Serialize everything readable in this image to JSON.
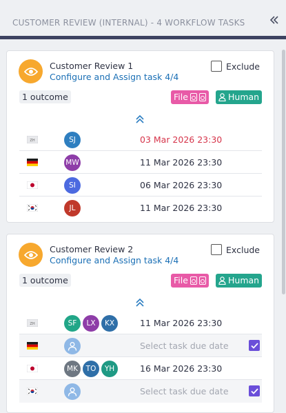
{
  "header": {
    "title": "CUSTOMER REVIEW (INTERNAL) - 4 WORKFLOW TASKS",
    "collapse_icon": "double-chevron-left-icon"
  },
  "cards": [
    {
      "name": "Customer Review 1",
      "subtitle": "Configure and Assign task 4/4",
      "exclude_label": "Exclude",
      "outcome": "1 outcome",
      "tag_file": "File",
      "tag_human": "Human",
      "rows": [
        {
          "flag": "zh",
          "avatars": [
            {
              "initials": "SJ",
              "color": "#2f7fc0"
            }
          ],
          "date": "03 Mar 2026 23:30",
          "overdue": true
        },
        {
          "flag": "de",
          "avatars": [
            {
              "initials": "MW",
              "color": "#8e3da8"
            }
          ],
          "date": "11 Mar 2026 23:30"
        },
        {
          "flag": "jp",
          "avatars": [
            {
              "initials": "SI",
              "color": "#4c6ae0"
            }
          ],
          "date": "06 Mar 2026 23:30"
        },
        {
          "flag": "kr",
          "avatars": [
            {
              "initials": "JL",
              "color": "#c0392b"
            }
          ],
          "date": "11 Mar 2026 23:30"
        }
      ]
    },
    {
      "name": "Customer Review 2",
      "subtitle": "Configure and Assign task 4/4",
      "exclude_label": "Exclude",
      "outcome": "1 outcome",
      "tag_file": "File",
      "tag_human": "Human",
      "rows": [
        {
          "flag": "zh",
          "avatars": [
            {
              "initials": "SF",
              "color": "#21a688"
            },
            {
              "initials": "LX",
              "color": "#8e3da8"
            },
            {
              "initials": "KX",
              "color": "#2f6fa8"
            }
          ],
          "date": "11 Mar 2026 23:30"
        },
        {
          "flag": "de",
          "avatars": [],
          "date": "Select task due date",
          "placeholder": true,
          "checked": true
        },
        {
          "flag": "jp",
          "avatars": [
            {
              "initials": "MK",
              "color": "#6e7782"
            },
            {
              "initials": "TO",
              "color": "#2f6fa8"
            },
            {
              "initials": "YH",
              "color": "#1f9a84"
            }
          ],
          "date": "16 Mar 2026 23:30"
        },
        {
          "flag": "kr",
          "avatars": [],
          "date": "Select task due date",
          "placeholder": true,
          "checked": true
        }
      ]
    }
  ],
  "colors": {
    "accent_orange": "#f7a82e",
    "file_tag": "#e85aa7",
    "human_tag": "#24a58d",
    "check": "#6a4ed9",
    "overdue": "#d6344a"
  }
}
